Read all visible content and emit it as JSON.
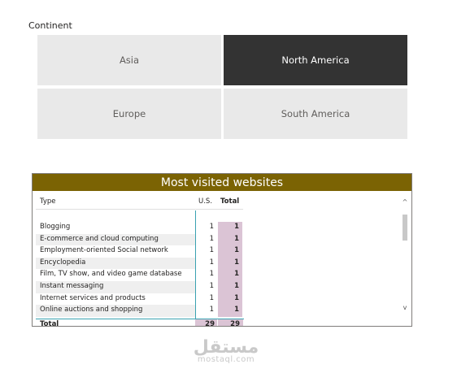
{
  "slicer": {
    "title": "Continent",
    "tiles": [
      {
        "label": "Asia",
        "selected": false
      },
      {
        "label": "North America",
        "selected": true
      },
      {
        "label": "Europe",
        "selected": false
      },
      {
        "label": "South America",
        "selected": false
      }
    ]
  },
  "table": {
    "title": "Most visited websites",
    "title_bg": "#7b6303",
    "headers": {
      "type": "Type",
      "us": "U.S.",
      "total": "Total"
    },
    "rows": [
      {
        "type": "Blogging",
        "us": "1",
        "total": "1"
      },
      {
        "type": "E-commerce and cloud computing",
        "us": "1",
        "total": "1"
      },
      {
        "type": "Employment-oriented Social network",
        "us": "1",
        "total": "1"
      },
      {
        "type": "Encyclopedia",
        "us": "1",
        "total": "1"
      },
      {
        "type": "Film, TV show, and video game database",
        "us": "1",
        "total": "1"
      },
      {
        "type": "Instant messaging",
        "us": "1",
        "total": "1"
      },
      {
        "type": "Internet services and products",
        "us": "1",
        "total": "1"
      },
      {
        "type": "Online auctions and shopping",
        "us": "1",
        "total": "1"
      }
    ],
    "total_row": {
      "label": "Total",
      "us": "29",
      "total": "29"
    },
    "highlight_color": "#dbc4d5"
  },
  "watermark": {
    "arabic": "مستقل",
    "latin": "mostaql.com"
  }
}
